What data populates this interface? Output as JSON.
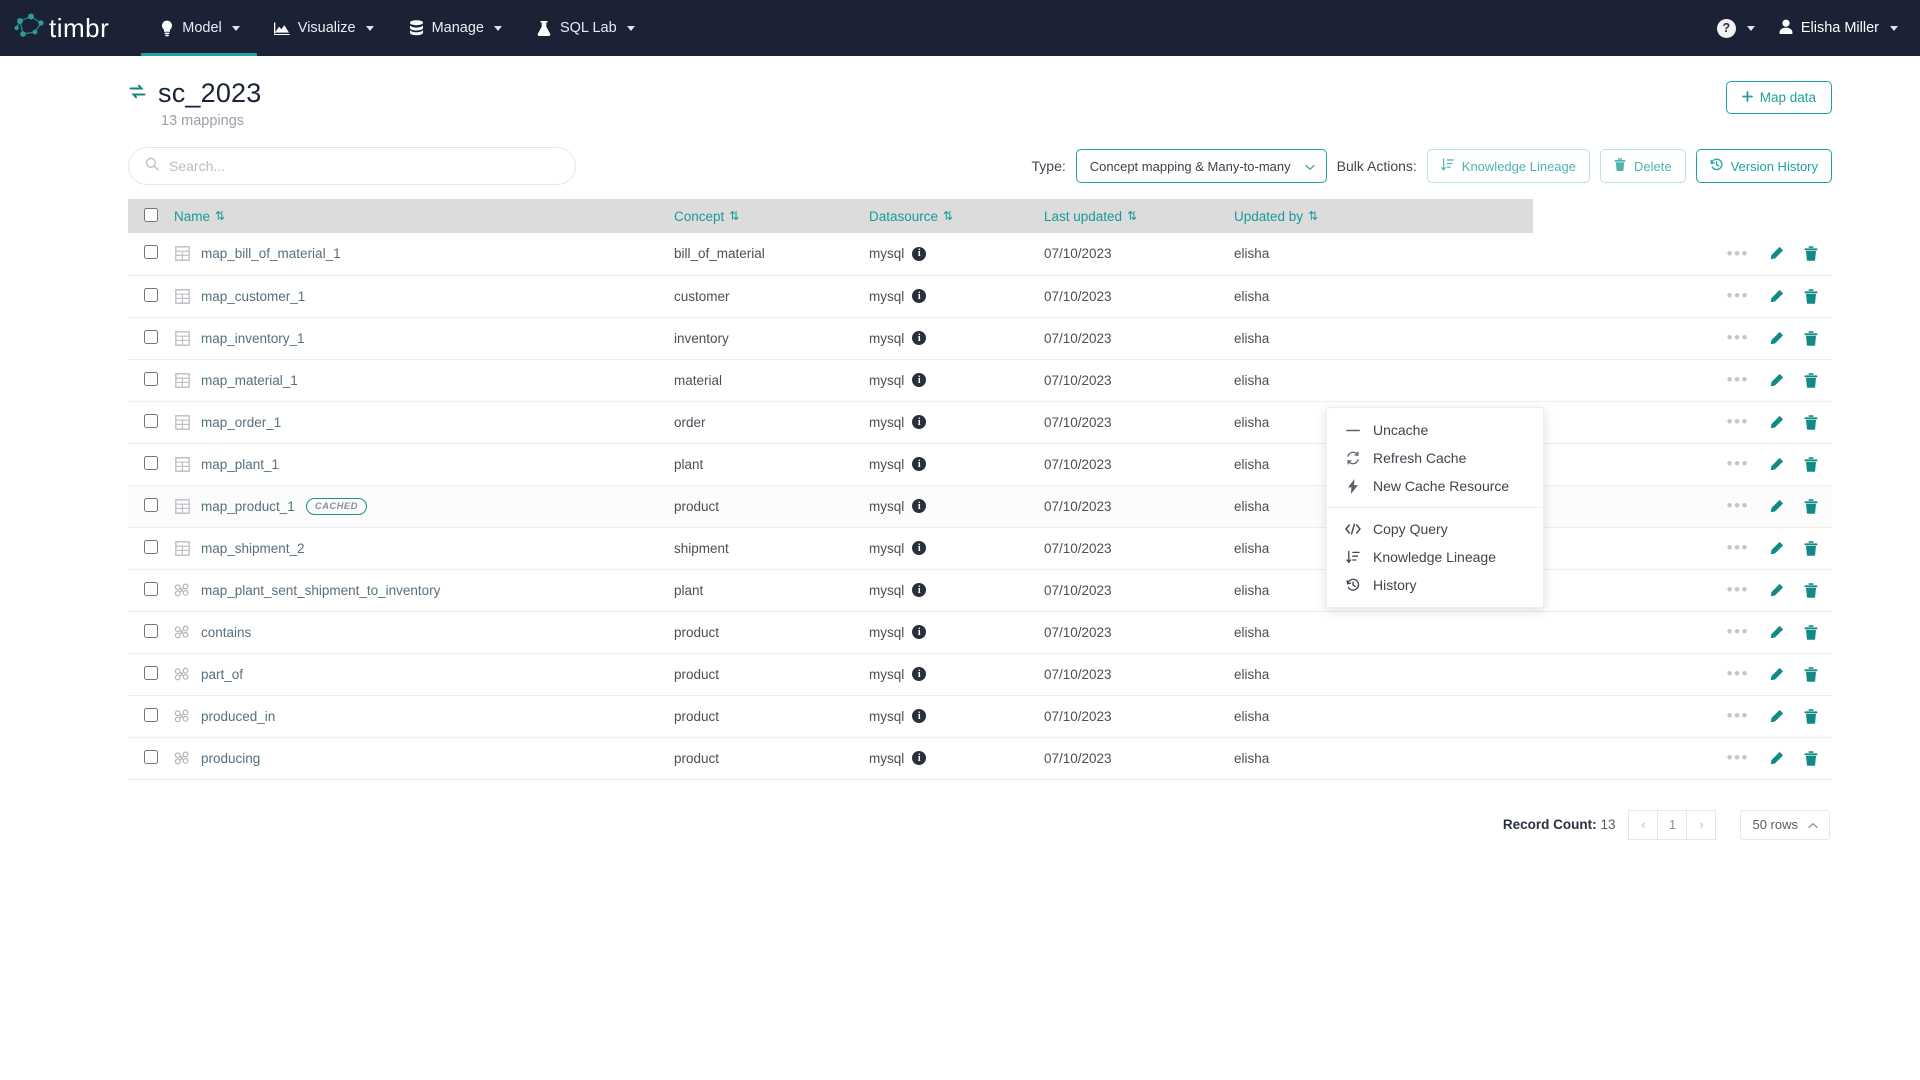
{
  "topnav": {
    "brand": "timbr",
    "brand_icon": "timbr-logo-icon",
    "items": [
      {
        "label": "Model",
        "icon": "lightbulb-icon",
        "active": true
      },
      {
        "label": "Visualize",
        "icon": "chart-icon",
        "active": false
      },
      {
        "label": "Manage",
        "icon": "database-icon",
        "active": false
      },
      {
        "label": "SQL Lab",
        "icon": "flask-icon",
        "active": false
      }
    ],
    "help_label": "?",
    "user_name": "Elisha Miller",
    "accent": "#1fa2a0",
    "bg": "#1b2236"
  },
  "header": {
    "icon": "sync-refresh-icon",
    "title": "sc_2023",
    "subtitle": "13 mappings",
    "map_data_label": "Map data",
    "map_data_icon": "plus-icon"
  },
  "toolbar": {
    "search_placeholder": "Search...",
    "search_value": "",
    "search_icon": "search-icon",
    "type_label": "Type:",
    "type_value": "Concept mapping & Many-to-many",
    "bulk_actions_label": "Bulk Actions:",
    "buttons": [
      {
        "label": "Knowledge Lineage",
        "icon": "sort-lineage-icon"
      },
      {
        "label": "Delete",
        "icon": "trash-icon"
      },
      {
        "label": "Version History",
        "icon": "history-icon"
      }
    ]
  },
  "table": {
    "columns": [
      {
        "label": "Name",
        "sortable": true
      },
      {
        "label": "Concept",
        "sortable": true
      },
      {
        "label": "Datasource",
        "sortable": true
      },
      {
        "label": "Last updated",
        "sortable": true
      },
      {
        "label": "Updated by",
        "sortable": true
      }
    ],
    "sort_icon": "sort-arrows-icon",
    "row_icons": {
      "more": "ellipsis-icon",
      "edit": "pencil-icon",
      "delete": "trash-icon",
      "info": "info-icon"
    },
    "rows": [
      {
        "name": "map_bill_of_material_1",
        "icon": "table-grid-icon",
        "badge": "",
        "concept": "bill_of_material",
        "datasource": "mysql",
        "last_updated": "07/10/2023",
        "updated_by": "elisha"
      },
      {
        "name": "map_customer_1",
        "icon": "table-grid-icon",
        "badge": "",
        "concept": "customer",
        "datasource": "mysql",
        "last_updated": "07/10/2023",
        "updated_by": "elisha"
      },
      {
        "name": "map_inventory_1",
        "icon": "table-grid-icon",
        "badge": "",
        "concept": "inventory",
        "datasource": "mysql",
        "last_updated": "07/10/2023",
        "updated_by": "elisha"
      },
      {
        "name": "map_material_1",
        "icon": "table-grid-icon",
        "badge": "",
        "concept": "material",
        "datasource": "mysql",
        "last_updated": "07/10/2023",
        "updated_by": "elisha"
      },
      {
        "name": "map_order_1",
        "icon": "table-grid-icon",
        "badge": "",
        "concept": "order",
        "datasource": "mysql",
        "last_updated": "07/10/2023",
        "updated_by": "elisha"
      },
      {
        "name": "map_plant_1",
        "icon": "table-grid-icon",
        "badge": "",
        "concept": "plant",
        "datasource": "mysql",
        "last_updated": "07/10/2023",
        "updated_by": "elisha"
      },
      {
        "name": "map_product_1",
        "icon": "table-grid-icon",
        "badge": "CACHED",
        "concept": "product",
        "datasource": "mysql",
        "last_updated": "07/10/2023",
        "updated_by": "elisha"
      },
      {
        "name": "map_shipment_2",
        "icon": "table-grid-icon",
        "badge": "",
        "concept": "shipment",
        "datasource": "mysql",
        "last_updated": "07/10/2023",
        "updated_by": "elisha"
      },
      {
        "name": "map_plant_sent_shipment_to_inventory",
        "icon": "relationship-icon",
        "badge": "",
        "concept": "plant",
        "datasource": "mysql",
        "last_updated": "07/10/2023",
        "updated_by": "elisha"
      },
      {
        "name": "contains",
        "icon": "relationship-icon",
        "badge": "",
        "concept": "product",
        "datasource": "mysql",
        "last_updated": "07/10/2023",
        "updated_by": "elisha"
      },
      {
        "name": "part_of",
        "icon": "relationship-icon",
        "badge": "",
        "concept": "product",
        "datasource": "mysql",
        "last_updated": "07/10/2023",
        "updated_by": "elisha"
      },
      {
        "name": "produced_in",
        "icon": "relationship-icon",
        "badge": "",
        "concept": "product",
        "datasource": "mysql",
        "last_updated": "07/10/2023",
        "updated_by": "elisha"
      },
      {
        "name": "producing",
        "icon": "relationship-icon",
        "badge": "",
        "concept": "product",
        "datasource": "mysql",
        "last_updated": "07/10/2023",
        "updated_by": "elisha"
      }
    ]
  },
  "context_menu": {
    "group1": [
      {
        "label": "Uncache",
        "icon": "minus-icon"
      },
      {
        "label": "Refresh Cache",
        "icon": "refresh-icon"
      },
      {
        "label": "New Cache Resource",
        "icon": "lightning-icon"
      }
    ],
    "group2": [
      {
        "label": "Copy Query",
        "icon": "code-icon"
      },
      {
        "label": "Knowledge Lineage",
        "icon": "sort-lineage-icon"
      },
      {
        "label": "History",
        "icon": "history-icon"
      }
    ]
  },
  "pagination": {
    "record_count_label": "Record Count:",
    "record_count_value": "13",
    "prev": "‹",
    "page": "1",
    "next": "›",
    "rows_per_page": "50 rows"
  }
}
